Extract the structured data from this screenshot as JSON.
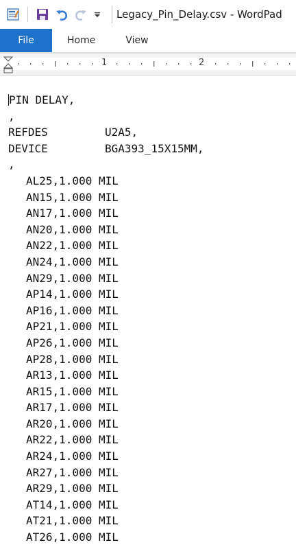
{
  "window": {
    "title": "Legacy_Pin_Delay.csv - WordPad"
  },
  "quick_access": {
    "icons": [
      "wordpad-app-icon",
      "save-icon",
      "undo-icon",
      "redo-icon",
      "customize-dropdown-icon"
    ]
  },
  "ribbon": {
    "tabs": [
      {
        "label": "File"
      },
      {
        "label": "Home"
      },
      {
        "label": "View"
      }
    ]
  },
  "ruler": {
    "labels": [
      "1",
      "2"
    ]
  },
  "document": {
    "header": "PIN DELAY,",
    "comma1": ",",
    "refdes_key": "REFDES",
    "refdes_value": "U2A5,",
    "device_key": "DEVICE",
    "device_value": "BGA393_15X15MM,",
    "comma2": ",",
    "pins": [
      "AL25,1.000 MIL",
      "AN15,1.000 MIL",
      "AN17,1.000 MIL",
      "AN20,1.000 MIL",
      "AN22,1.000 MIL",
      "AN24,1.000 MIL",
      "AN29,1.000 MIL",
      "AP14,1.000 MIL",
      "AP16,1.000 MIL",
      "AP21,1.000 MIL",
      "AP26,1.000 MIL",
      "AP28,1.000 MIL",
      "AR13,1.000 MIL",
      "AR15,1.000 MIL",
      "AR17,1.000 MIL",
      "AR20,1.000 MIL",
      "AR22,1.000 MIL",
      "AR24,1.000 MIL",
      "AR27,1.000 MIL",
      "AR29,1.000 MIL",
      "AT14,1.000 MIL",
      "AT21,1.000 MIL",
      "AT26,1.000 MIL"
    ]
  },
  "colors": {
    "file_tab": "#1e72c9",
    "save_icon": "#6a3fa0",
    "undo_icon": "#3a7bd5"
  }
}
